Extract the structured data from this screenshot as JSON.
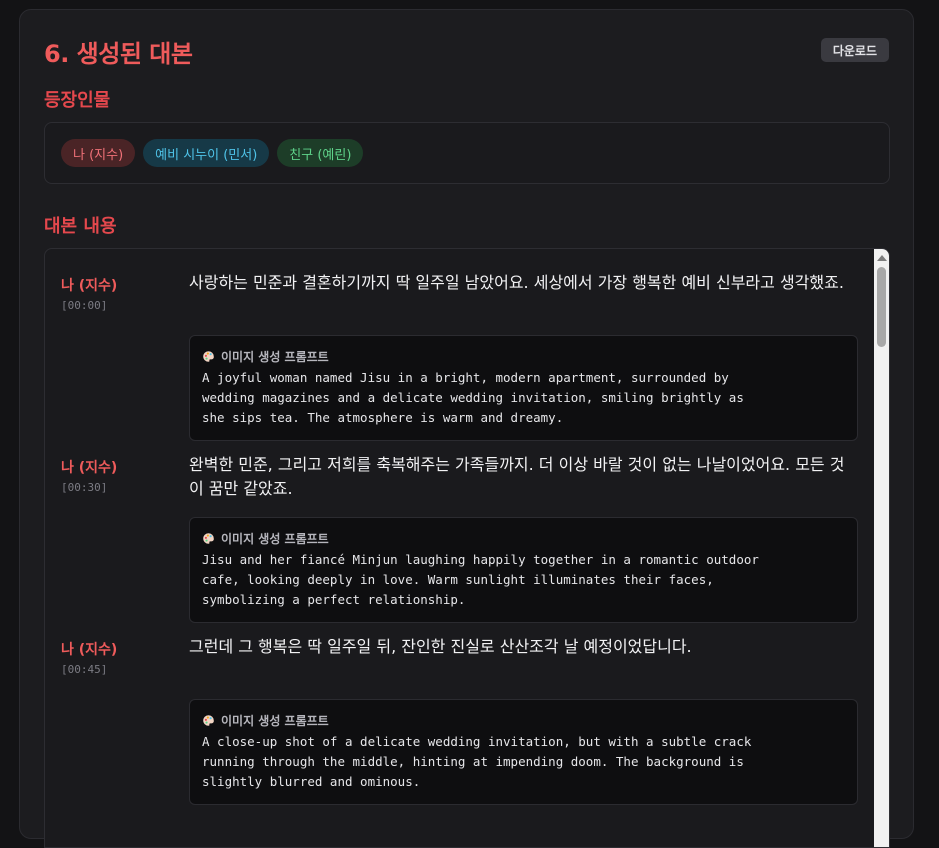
{
  "header": {
    "title": "6. 생성된 대본",
    "download_label": "다운로드"
  },
  "characters": {
    "heading": "등장인물",
    "items": [
      {
        "label": "나 (지수)",
        "color": "#f07178"
      },
      {
        "label": "예비 시누이 (민서)",
        "color": "#4fc3e8"
      },
      {
        "label": "친구 (예린)",
        "color": "#5fd38a"
      }
    ]
  },
  "script": {
    "heading": "대본 내용",
    "lines": [
      {
        "speaker": "나 (지수)",
        "time": "[00:00]",
        "text": "사랑하는 민준과 결혼하기까지 딱 일주일 남았어요. 세상에서 가장 행복한 예비 신부라고 생각했죠.",
        "prompt_label": "이미지 생성 프롬프트",
        "prompt_icon": "palette-icon",
        "prompt": "A joyful woman named Jisu in a bright, modern apartment, surrounded by\nwedding magazines and a delicate wedding invitation, smiling brightly as\nshe sips tea. The atmosphere is warm and dreamy."
      },
      {
        "speaker": "나 (지수)",
        "time": "[00:30]",
        "text": "완벽한 민준, 그리고 저희를 축복해주는 가족들까지. 더 이상 바랄 것이 없는 나날이었어요. 모든 것이 꿈만 같았죠.",
        "prompt_label": "이미지 생성 프롬프트",
        "prompt_icon": "palette-icon",
        "prompt": "Jisu and her fiancé Minjun laughing happily together in a romantic outdoor\ncafe, looking deeply in love. Warm sunlight illuminates their faces,\nsymbolizing a perfect relationship."
      },
      {
        "speaker": "나 (지수)",
        "time": "[00:45]",
        "text": "그런데 그 행복은 딱 일주일 뒤, 잔인한 진실로 산산조각 날 예정이었답니다.",
        "prompt_label": "이미지 생성 프롬프트",
        "prompt_icon": "palette-icon",
        "prompt": "A close-up shot of a delicate wedding invitation, but with a subtle crack\nrunning through the middle, hinting at impending doom. The background is\nslightly blurred and ominous."
      }
    ]
  },
  "colors": {
    "accent": "#ef5b5b",
    "background": "#1c1c1f"
  }
}
